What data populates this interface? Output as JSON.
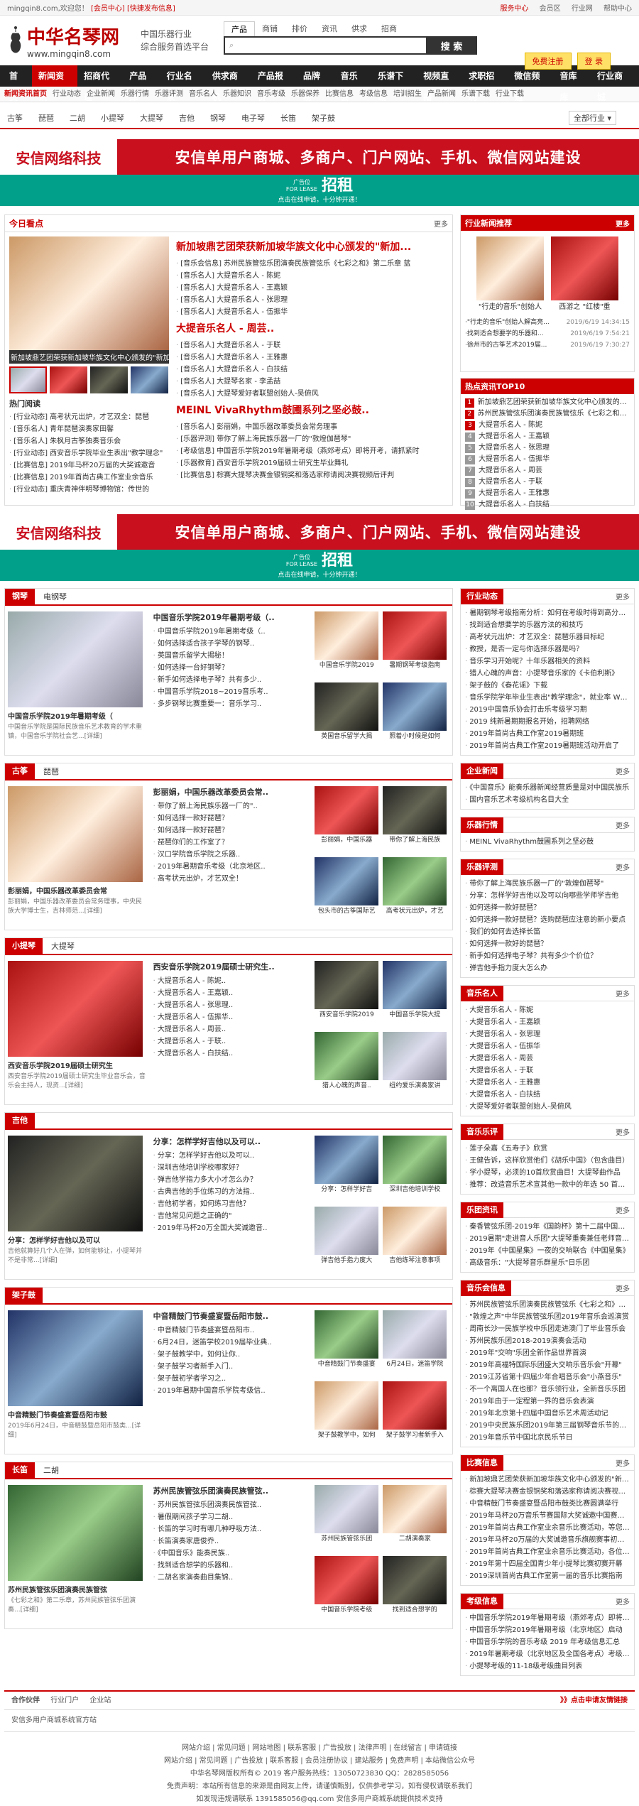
{
  "topbar": {
    "welcome": "mingqin8.com,欢迎您！",
    "member": "[会员中心]",
    "publish": "[快捷发布信息]",
    "links": [
      "服务中心",
      "会员区",
      "行业网",
      "帮助中心"
    ]
  },
  "logo": {
    "title": "中华名琴网",
    "url": "www.mingqin8.com"
  },
  "slogan": [
    "中国乐器行业",
    "综合服务首选平台"
  ],
  "search": {
    "tabs": [
      "产品",
      "商铺",
      "排价",
      "资讯",
      "供求",
      "招商"
    ],
    "placeholder": "",
    "button": "搜 索"
  },
  "header_btns": [
    "免费注册",
    "登 录"
  ],
  "nav": [
    "首页",
    "新闻资讯",
    "招商代理",
    "产品库",
    "行业名录",
    "供求商机",
    "产品报价",
    "品牌榜",
    "音乐会",
    "乐谱下载",
    "视频直播",
    "求职招聘",
    "微信频道",
    "音库库",
    "行业商城"
  ],
  "subnav": [
    "新闻资讯首页",
    "行业动态",
    "企业新闻",
    "乐器行情",
    "乐器评测",
    "音乐名人",
    "乐器知识",
    "音乐考级",
    "乐器保养",
    "比赛信息",
    "考级信息",
    "培训招生",
    "产品新闻",
    "乐谱下载",
    "行业下载"
  ],
  "cats": {
    "items": [
      "古筝",
      "琵琶",
      "二胡",
      "小提琴",
      "大提琴",
      "吉他",
      "钢琴",
      "电子琴",
      "长笛",
      "架子鼓"
    ],
    "all": "全部行业 ▾"
  },
  "banner": {
    "left": "安信网络科技",
    "right": "安信单用户商城、多商户、门户网站、手机、微信网站建设",
    "ad_small": "广告位",
    "ad_for": "FOR LEASE",
    "ad_big": "招租",
    "ad_sub": "点击在线申请，十分钟开通！"
  },
  "today": {
    "title": "今日看点",
    "more": "更多",
    "main_cap": "新加坡鼎艺团荣获新加坡华族文化中心颁发的\"新加",
    "heads": [
      "新加坡鼎艺团荣获新加坡华族文化中心颁发的\"新加...",
      "大提音乐名人 - 周芸..",
      "MEINL VivaRhythm鼓圃系列之坚必鼓.."
    ],
    "list1": [
      "[音乐会信息] 苏州民族管弦乐团演奏民族管弦乐《七彩之和》第二乐章 蓝",
      "[音乐名人] 大提音乐名人 - 陈妮",
      "[音乐名人] 大提音乐名人 - 王嘉颖",
      "[音乐名人] 大提音乐名人 - 张思理",
      "[音乐名人] 大提音乐名人 - 伍振华"
    ],
    "list2": [
      "[音乐名人] 大提音乐名人 - 于联",
      "[音乐名人] 大提音乐名人 - 王雅惠",
      "[音乐名人] 大提音乐名人 - 白扶结",
      "[音乐名人] 大提琴名家 - 李孟喆",
      "[音乐名人] 大提琴爱好者联盟创始人-吴俯风"
    ],
    "list3": [
      "[音乐名人] 彭丽娟，中国乐器改革委员会常务理事",
      "[乐器评测] 带你了解上海民族乐器一厂的\"敦煌伽琶琴\"",
      "[考级信息] 中国音乐学院2019年暑期考级（燕郊考点）即将开考，请抓紧时",
      "[乐器教育] 西安音乐学院2019届硕士研究生毕业舞礼",
      "[比赛信息] 棕赛大提琴决赛金银铜奖和落选家称请阅决赛视频后评判"
    ],
    "hot_title": "热门阅读",
    "hot": [
      "[行业动态] 高考状元出炉，才艺双全：琵琶",
      "[音乐名人] 青年琵琶演奏家田馨",
      "[音乐名人] 朱枫月古筝独奏音乐会",
      "[行业动态] 西安音乐学院毕业生表出\"教学理念\"",
      "[比赛信息] 2019年马杯20万届的大奖诚邀音",
      "[比赛信息] 2019年首尚古典工作室业余音乐",
      "[行业动态] 重庆青神伴明琴博物馆：传世的"
    ]
  },
  "side_recommend": {
    "title": "行业新闻推荐",
    "more": "更多",
    "caps": [
      "\"行走的音乐\"创始人",
      "西游之 \"红楼\"重"
    ],
    "items": [
      {
        "t": "·\"行走的音乐\"创始人解高亮...",
        "d": "2019/6/19 14:34:15"
      },
      {
        "t": "·找到适合想要学的乐器和...",
        "d": "2019/6/19 7:54:21"
      },
      {
        "t": "·徐州市的古筝艺术2019届...",
        "d": "2019/6/19 7:30:27"
      }
    ]
  },
  "top10": {
    "title": "热点资讯TOP10",
    "items": [
      "新加坡鼎艺团荣获新加坡华族文化中心颁发的\"新加坡",
      "苏州民族管弦乐团演奏民族管弦乐《七彩之和》第二乐",
      "大提音乐名人 - 陈妮",
      "大提音乐名人 - 王嘉颖",
      "大提音乐名人 - 张思理",
      "大提音乐名人 - 伍振华",
      "大提音乐名人 - 周芸",
      "大提音乐名人 - 于联",
      "大提音乐名人 - 王雅惠",
      "大提音乐名人 - 白扶结"
    ]
  },
  "channels": [
    {
      "tag": "钢琴",
      "tag2": "电钢琴",
      "cap": "中国音乐学院2019年暑期考级（",
      "desc": "中国音乐学院是国际民族音乐艺术教育的学术重镇，中国音乐学院社会艺...[详细]",
      "headline": "中国音乐学院2019年暑期考级（..",
      "items": [
        "中国音乐学院2019年暑期考级（..",
        "如何选择适合孩子学琴的钢琴..",
        "英国音乐留学大揭秘！",
        "如何选择一台好钢琴？",
        "新手如何选择电子琴？共有多少..",
        "中国音乐学院2018~2019音乐考..",
        "多步钢琴比赛重要一：音乐学习.."
      ],
      "thumbs": [
        "中国音乐学院2019",
        "暑期钢琴考级指南",
        "英国音乐留学大揭",
        "照着小时候是如何"
      ]
    },
    {
      "tag": "古筝",
      "tag2": "琵琶",
      "cap": "彭丽娟，中国乐器改革委员会常",
      "desc": "彭丽娟，中国乐器改革委员会常务理事，中央民族大学博士生，吉林师范...[详细]",
      "headline": "彭丽娟，中国乐器改革委员会常..",
      "items": [
        "带你了解上海民族乐器一厂的\"..",
        "如何选择一款好琵琶？",
        "如何选择一款好琵琶？",
        "琵琶你们的工作室了？",
        "汉口学院音乐学院之乐器..",
        "2019年暑期音乐考级（北京地区..",
        "高考状元出炉，才艺双全！"
      ],
      "thumbs": [
        "彭丽娟，中国乐器",
        "带你了解上海民族",
        "包头市的古筝国际艺",
        "高考状元出炉，才艺"
      ]
    },
    {
      "tag": "小提琴",
      "tag2": "大提琴",
      "cap": "西安音乐学院2019届硕士研究生",
      "desc": "西安音乐学院2019届硕士研究生毕业音乐会，音乐会主持人，现资...[详细]",
      "headline": "西安音乐学院2019届硕士研究生..",
      "items": [
        "大提音乐名人 - 陈妮..",
        "大提音乐名人 - 王嘉颖..",
        "大提音乐名人 - 张思理..",
        "大提音乐名人 - 伍振华..",
        "大提音乐名人 - 周芸..",
        "大提音乐名人 - 于联..",
        "大提音乐名人 - 白扶结.."
      ],
      "thumbs": [
        "西安音乐学院2019",
        "中国音乐学院大提",
        "猎人心魄的声音..",
        "纽约爱乐演奏家讲"
      ]
    },
    {
      "tag": "吉他",
      "tag2": "",
      "cap": "分享：怎样学好吉他以及可以",
      "desc": "吉他就算好几个人在弹，如何能够让，小提琴并不是非常...[详细]",
      "headline": "分享：怎样学好吉他以及可以..",
      "items": [
        "分享：怎样学好吉他以及可以..",
        "深圳吉他培训学校哪家好？",
        "弹吉他学指力多大小才怎么办？",
        "古典吉他的手位练习的方法指..",
        "吉他初学者，如何练习吉他？",
        "吉他常见问题之正确的\"",
        "2019年马杯20万全国大奖诚邀音.."
      ],
      "thumbs": [
        "分享：怎样学好吉",
        "深圳吉他培训学校",
        "弹吉他手指力度大",
        "吉他练琴注意事项"
      ]
    },
    {
      "tag": "架子鼓",
      "tag2": "",
      "cap": "中音精鼓门节奏盛宴暨岳阳市鼓",
      "desc": "2019年6月24日，中音精鼓暨岳阳市鼓类...[详细]",
      "headline": "中音精鼓门节奏盛宴暨岳阳市鼓..",
      "items": [
        "中音精鼓门节奏盛宴暨岳阳市..",
        "6月24日，迷笛学校2019届毕业典..",
        "架子鼓教学中，如何让你..",
        "架子鼓学习者新手入门..",
        "架子鼓初学者学习之..",
        "2019年暑期中国音乐学院考级信.."
      ],
      "thumbs": [
        "中音精鼓门节奏盛宴",
        "6月24日，迷笛学院",
        "架子鼓教学中，如何",
        "架子鼓学习者新手入"
      ]
    },
    {
      "tag": "长笛",
      "tag2": "二胡",
      "cap": "苏州民族管弦乐团演奏民族管弦",
      "desc": "《七彩之和》第二乐章，苏州民族管弦乐团演奏...[详细]",
      "headline": "苏州民族管弦乐团演奏民族管弦..",
      "items": [
        "苏州民族管弦乐团演奏民族管弦..",
        "暑假期间孩子学习二胡..",
        "长笛的学习时有哪几种呼吸方法..",
        "长笛演奏家唐俊乔..",
        "《中国音乐》能奏民族..",
        "找到适合想学的乐器和..",
        "二胡名家演奏曲目集锦.."
      ],
      "thumbs": [
        "苏州民族管弦乐团",
        "二胡演奏家",
        "中国音乐学院考级",
        "找到适合想学的"
      ]
    }
  ],
  "right_boxes": [
    {
      "title": "行业动态",
      "items": [
        "暑期钢琴考级指南分析：如何在考级时得到高分，考前",
        "找到适合想要学的乐器方法的和技巧",
        "高考状元出炉：才艺双全：琵琶乐器目标纪",
        "教授，是否一定与你选择乐器是吗？",
        "音乐学习开始呢？十年乐器相关的资料",
        "猎人心魄的声音：小提琴音乐家的《卡伯利斯》",
        "架子鼓的《春花谣》下载",
        "音乐学院学年毕业生表出\"教学理念\"，就业率 Why & How",
        "2019中国音乐协会打击乐考级学习期",
        "2019 纯新暑期期报名开始，招聘网络",
        "2019年首尚古典工作室2019暑期班",
        "2019年首尚古典工作室2019暑期班活动开启了"
      ]
    },
    {
      "title": "企业新闻",
      "items": [
        "《中国音乐》能奏乐器新闻经营质量是对中国民族乐",
        "国内音乐艺术考级机构名目大全"
      ]
    },
    {
      "title": "乐器行情",
      "items": [
        "MEINL VivaRhythm鼓圃系列之坚必鼓"
      ]
    },
    {
      "title": "乐器评测",
      "items": [
        "带你了解上海民族乐器一厂的\"敦煌伽琶琴\"",
        "分享：怎样学好吉他以及可以向哪些学师学吉他",
        "如何选择一款好琵琶？",
        "如何选择一款好琵琶？选购琵琶应注意的新小要点",
        "我们的如何去选择长笛",
        "如何选择一款好的琵琶？",
        "新手如何选择电子琴？共有多少个价位？",
        "弹吉他手指力度大怎么办"
      ]
    },
    {
      "title": "音乐名人",
      "items": [
        "大提音乐名人 - 陈妮",
        "大提音乐名人 - 王嘉颖",
        "大提音乐名人 - 张思理",
        "大提音乐名人 - 伍振华",
        "大提音乐名人 - 周芸",
        "大提音乐名人 - 于联",
        "大提音乐名人 - 王雅惠",
        "大提音乐名人 - 白扶结",
        "大提琴爱好者联盟创始人-吴俯风"
      ]
    },
    {
      "title": "音乐乐评",
      "items": [
        "莲子朵嘉《五寿子》欣赏",
        "王健告诉，这样欣赏他们《胡乐中国》（包含曲目）",
        "学小提琴，必须的10首欣赏曲目！大提琴曲作品",
        "推荐：改造音乐艺术宣其他一款中的年选 50 首曲子"
      ]
    },
    {
      "title": "乐团资讯",
      "items": [
        "秦香管弦乐团-2019年《国韵杯》第十二届中国国际艺术",
        "2019暑期\"走进音人乐团\"大提琴重奏兼任老师音乐会",
        "2019年《中国星集》一夜的交响联合《中国星集》",
        "高级音乐：\"大提琴音乐群星乐\"日乐团"
      ]
    },
    {
      "title": "音乐会信息",
      "items": [
        "苏州民族管弦乐团演奏民族管弦乐《七彩之和》第二乐",
        "\"敦煌之声\"中华民族管弦乐团2019年音乐会巡演赏",
        "周南长沙一民族学校中乐团走进澳门了毕业音乐会",
        "苏州民族乐团2018-2019演奏会活动",
        "2019年\"交响\"乐团全新作品世界首演",
        "2019年高福特国际乐团盛大交响乐音乐会\"开幕\"",
        "2019江苏省第十四届少年合唱音乐会\"小燕音乐\"",
        "不一个离国人在也那？音乐领行业，全新音乐乐团",
        "2019年由于一定程第一界的音乐会表演",
        "2019年北京第十四届中国音乐艺术周活动记",
        "2019中央民族乐团2019年第三届钢琴音乐节的一和",
        "2019年音乐节中国北京民乐节日"
      ]
    },
    {
      "title": "比赛信息",
      "items": [
        "新加坡鼎艺团荣获新加坡华族文化中心颁发的\"新加坡",
        "棕赛大提琴决赛金银铜奖和落选家称请阅决赛视频后",
        "中音精鼓门节奏盛宴暨岳阳市鼓类比赛圆满举行",
        "2019年马杯20万音乐节赛国际大奖诚邀中国赛选拔",
        "2019年首尚古典工作室业余音乐比赛活动，等您来参加",
        "2019年马杯20万届的大奖诚邀音乐旗舰赛事初选赛",
        "2019年首尚古典工作室业余音乐比赛活动，各位朋友",
        "2019年第十四届全国青少年小提琴比赛初赛开幕",
        "2019深圳首尚古典工作室第一届的音乐比赛指南"
      ]
    },
    {
      "title": "考级信息",
      "items": [
        "中国音乐学院2019年暑期考级（燕郊考点）即将开考",
        "中国音乐学院2019年暑期考级（北京地区）启动",
        "中国音乐学院的音乐考级 2019 年考级信息汇总",
        "2019年暑期考级（北京地区及全国各考点）考级时间",
        "小提琴考级的11-18级考级曲目列表"
      ]
    }
  ],
  "footer": {
    "apply": "》》点击申请友情链接",
    "links_tag": "合作伙伴",
    "links_tabs": [
      "行业门户",
      "企业站"
    ],
    "links": [
      "安信多用户商城系统官方站"
    ],
    "row1": "网站介绍 | 常见问题 | 网站地图 | 联系客服 | 广告投放 | 法律声明 | 在线留言 | 申请链接",
    "row2": "网站介绍 | 常见问题 | 广告投放 | 联系客服 | 会员注册协议 | 建站服务 | 免费声明 | 本站微信公众号",
    "row3": "中华名琴网版权所有© 2019    客户服务热线：13050723830    QQ：2828585056",
    "row4": "免责声明：本站所有信息的来源是由网友上传，请谨慎甄别，仅供参考学习，如有侵权请联系我们",
    "row5": "如发现违规请联系 1391585056@qq.com 安信多用户商城系统提供技术支持"
  }
}
